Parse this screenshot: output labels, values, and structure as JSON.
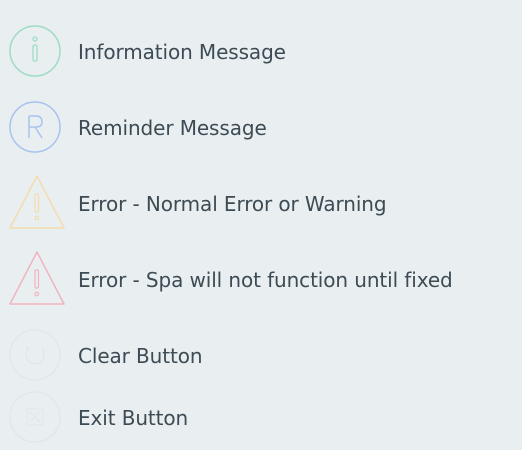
{
  "legend": {
    "items": [
      {
        "icon": "info-circle-icon",
        "label": "Information Message",
        "color": "#9fdcc4"
      },
      {
        "icon": "reminder-r-circle-icon",
        "label": "Reminder Message",
        "color": "#a8c4ee"
      },
      {
        "icon": "warning-triangle-icon",
        "label": "Error - Normal Error or Warning",
        "color": "#f3dcae"
      },
      {
        "icon": "critical-warning-triangle-icon",
        "label": "Error - Spa will not function until fixed",
        "color": "#f1b4bf"
      },
      {
        "icon": "clear-circle-icon",
        "label": "Clear Button",
        "color": "#e3e7ea"
      },
      {
        "icon": "exit-circle-icon",
        "label": "Exit Button",
        "color": "#e3e7ea"
      }
    ]
  }
}
